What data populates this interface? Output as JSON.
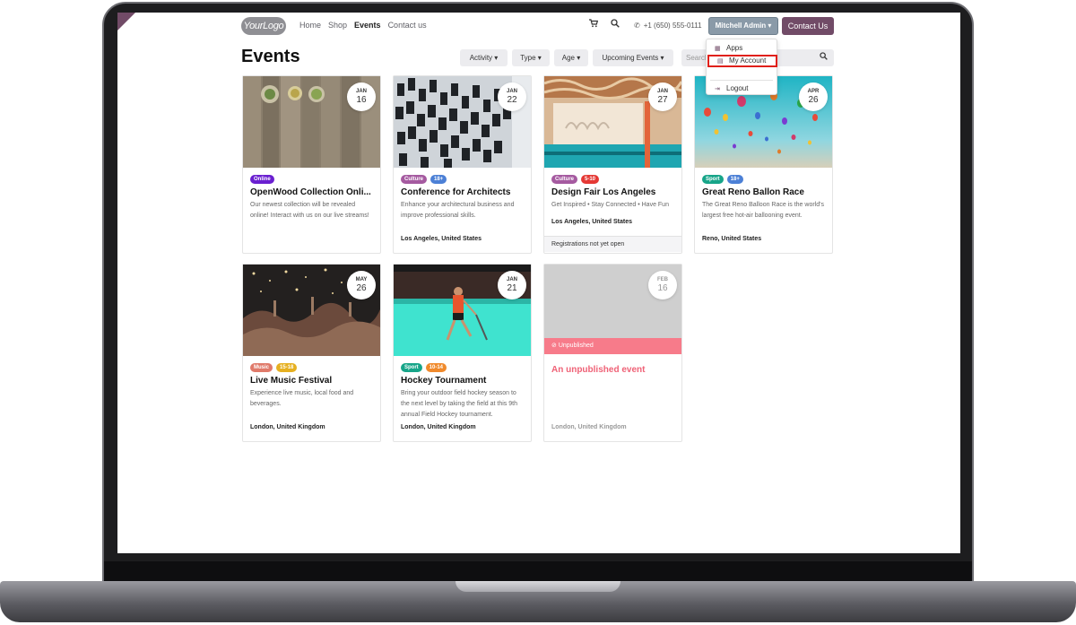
{
  "header": {
    "logo_text": "YourLogo",
    "nav": [
      "Home",
      "Shop",
      "Events",
      "Contact us"
    ],
    "phone": "+1 (650) 555-0111",
    "user_menu": "Mitchell Admin",
    "contact_button": "Contact Us"
  },
  "user_dropdown": {
    "items": [
      "Apps",
      "My Account",
      "Logout"
    ],
    "highlighted": "My Account"
  },
  "page": {
    "title": "Events",
    "filters": [
      "Activity",
      "Type",
      "Age",
      "Upcoming Events"
    ],
    "search_placeholder": "Search"
  },
  "events": [
    {
      "month": "JAN",
      "day": "16",
      "tags": [
        {
          "label": "Online",
          "color": "#6a1fd0"
        }
      ],
      "title": "OpenWood Collection Onli...",
      "description": "Our newest collection will be revealed online! Interact with us on our live streams!",
      "location": ""
    },
    {
      "month": "JAN",
      "day": "22",
      "tags": [
        {
          "label": "Culture",
          "color": "#a55aa0"
        },
        {
          "label": "18+",
          "color": "#4c80d6"
        }
      ],
      "title": "Conference for Architects",
      "description": "Enhance your architectural business and improve professional skills.",
      "location": "Los Angeles, United States"
    },
    {
      "month": "JAN",
      "day": "27",
      "tags": [
        {
          "label": "Culture",
          "color": "#a55aa0"
        },
        {
          "label": "5-10",
          "color": "#e53935"
        }
      ],
      "title": "Design Fair Los Angeles",
      "description": "Get Inspired • Stay Connected • Have Fun",
      "location": "Los Angeles, United States",
      "footer": "Registrations not yet open"
    },
    {
      "month": "APR",
      "day": "26",
      "tags": [
        {
          "label": "Sport",
          "color": "#17a589"
        },
        {
          "label": "18+",
          "color": "#4c80d6"
        }
      ],
      "title": "Great Reno Ballon Race",
      "description": "The Great Reno Balloon Race is the world's largest free hot-air ballooning event.",
      "location": "Reno, United States"
    },
    {
      "month": "MAY",
      "day": "26",
      "tags": [
        {
          "label": "Music",
          "color": "#e07a6a"
        },
        {
          "label": "15-18",
          "color": "#e6b021"
        }
      ],
      "title": "Live Music Festival",
      "description": "Experience live music, local food and beverages.",
      "location": "London, United Kingdom"
    },
    {
      "month": "JAN",
      "day": "21",
      "tags": [
        {
          "label": "Sport",
          "color": "#17a589"
        },
        {
          "label": "10-14",
          "color": "#f08a2c"
        }
      ],
      "title": "Hockey Tournament",
      "description": "Bring your outdoor field hockey season to the next level by taking the field at this 9th annual Field Hockey tournament.",
      "location": "London, United Kingdom"
    },
    {
      "month": "FEB",
      "day": "16",
      "tags": [],
      "status": "Unpublished",
      "title": "An unpublished event",
      "description": "",
      "location": "London, United Kingdom"
    }
  ],
  "colors": {
    "brand": "#714b67",
    "user_button": "#8a9aa8",
    "unpublished": "#f77b8a",
    "highlight_box": "#e0201a"
  }
}
